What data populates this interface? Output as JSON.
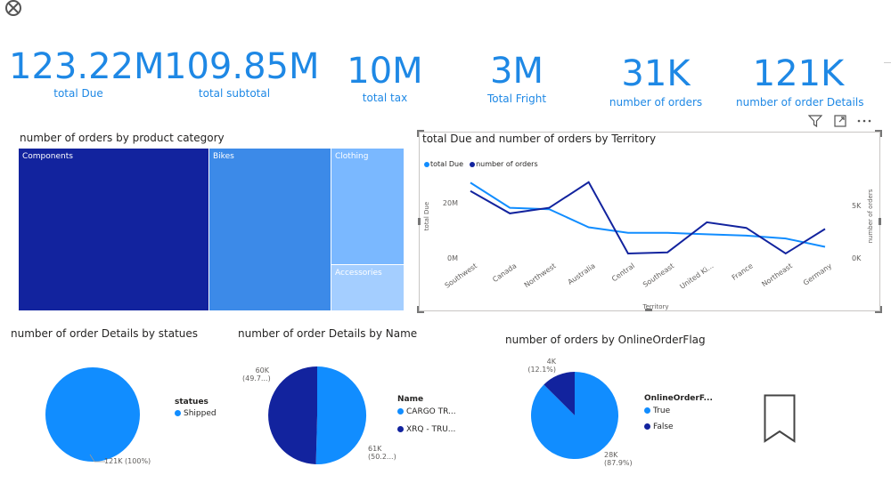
{
  "kpis": [
    {
      "value": "123.22M",
      "label": "total Due"
    },
    {
      "value": "109.85M",
      "label": "total subtotal"
    },
    {
      "value": "10M",
      "label": "total tax"
    },
    {
      "value": "3M",
      "label": "Total Fright"
    },
    {
      "value": "31K",
      "label": "number of orders"
    },
    {
      "value": "121K",
      "label": "number of order Details"
    }
  ],
  "colors": {
    "dark": "#12239E",
    "mid": "#3C8AE8",
    "light": "#118DFF",
    "pale1": "#7AB8FF",
    "pale2": "#A4CEFF",
    "kpi": "#1E88E5"
  },
  "toolbar": {
    "filter_icon": "filter-icon",
    "focus_icon": "focus-mode-icon",
    "more_icon": "more-options-icon"
  },
  "treemap": {
    "title": "number of orders by product category",
    "chart_data": {
      "type": "treemap",
      "categories": [
        "Components",
        "Bikes",
        "Clothing",
        "Accessories"
      ]
    }
  },
  "line_chart": {
    "title": "total Due and number of orders by Territory",
    "legend": [
      "total Due",
      "number of orders"
    ],
    "ylabel_left": "total Due",
    "ylabel_right": "number of orders",
    "xlabel": "Territory",
    "yticks_left": [
      "20M",
      "0M"
    ],
    "yticks_right": [
      "5K",
      "0K"
    ],
    "xticks": [
      "Southwest",
      "Canada",
      "Northwest",
      "Australia",
      "Central",
      "Southeast",
      "United Ki...",
      "France",
      "Northeast",
      "Germany"
    ]
  },
  "pie_status": {
    "title": "number of order Details by statues",
    "legend_title": "statues",
    "legend": [
      "Shipped"
    ],
    "label": "121K (100%)"
  },
  "pie_name": {
    "title": "number of order Details by Name",
    "legend_title": "Name",
    "legend": [
      "CARGO TR...",
      "XRQ - TRU..."
    ],
    "label_left_1": "60K",
    "label_left_2": "(49.7...)",
    "label_right_1": "61K",
    "label_right_2": "(50.2...)"
  },
  "pie_online": {
    "title": "number of orders by OnlineOrderFlag",
    "legend_title": "OnlineOrderF...",
    "legend": [
      "True",
      "False"
    ],
    "label_top_1": "4K",
    "label_top_2": "(12.1%)",
    "label_bottom_1": "28K",
    "label_bottom_2": "(87.9%)"
  },
  "chart_data": [
    {
      "type": "line",
      "title": "total Due and number of orders by Territory",
      "categories": [
        "Southwest",
        "Canada",
        "Northwest",
        "Australia",
        "Central",
        "Southeast",
        "United Ki...",
        "France",
        "Northeast",
        "Germany"
      ],
      "series": [
        {
          "name": "total Due",
          "axis": "left",
          "values": [
            27000000,
            18000000,
            17500000,
            11000000,
            9000000,
            9000000,
            8500000,
            8000000,
            7000000,
            4000000
          ]
        },
        {
          "name": "number of orders",
          "axis": "right",
          "values": [
            6000,
            4000,
            4500,
            6800,
            400,
            500,
            3200,
            2700,
            400,
            2600
          ]
        }
      ],
      "xlabel": "Territory",
      "ylabel": "total Due",
      "ylim": [
        0,
        30000000
      ],
      "y2lim": [
        0,
        7500
      ]
    },
    {
      "type": "pie",
      "title": "number of order Details by statues",
      "categories": [
        "Shipped"
      ],
      "values": [
        121000
      ]
    },
    {
      "type": "pie",
      "title": "number of order Details by Name",
      "categories": [
        "CARGO TR...",
        "XRQ - TRU..."
      ],
      "values": [
        61000,
        60000
      ]
    },
    {
      "type": "pie",
      "title": "number of orders by OnlineOrderFlag",
      "categories": [
        "True",
        "False"
      ],
      "values": [
        28000,
        4000
      ]
    }
  ]
}
